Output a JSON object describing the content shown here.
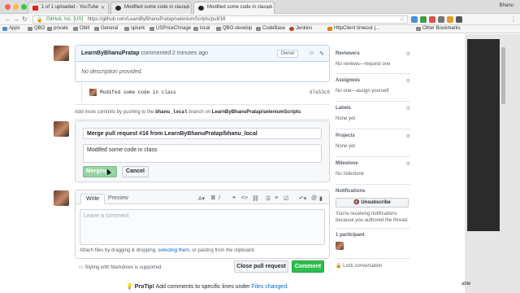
{
  "browser": {
    "tabs": [
      {
        "label": "1 of 1 uploaded - YouTube",
        "color": "#e62117"
      },
      {
        "label": "Modified some code in class b",
        "color": "#24292e"
      },
      {
        "label": "Modified some code in class b",
        "color": "#24292e"
      }
    ],
    "user": "Bhanu",
    "url_secure_label": "GitHub, Inc. [US]",
    "url": "https://github.com/LearnByBhanuPratap/seleniumScripts/pull/16",
    "bookmarks": [
      "Apps",
      "QBO",
      "private",
      "Obill",
      "General",
      "splunk",
      "USPriceChnage",
      "local",
      "QBO-develop",
      "CodeBase",
      "Jenkins",
      "HttpClient timeout |...",
      "Other Bookmarks"
    ]
  },
  "comment": {
    "author": "LearnByBhanuPratap",
    "action": "commented 2 minutes ago",
    "owner_badge": "Owner",
    "body": "No description provided."
  },
  "commit": {
    "message": "Modifed some code in class",
    "sha": "d7a53c6"
  },
  "more_commits": {
    "prefix": "Add more commits by pushing to the",
    "branch": "bhanu_local",
    "middle": "branch on",
    "repo": "LearnByBhanuPratap/seleniumScripts",
    "suffix": "."
  },
  "merge": {
    "title": "Merge pull request #16 from LearnByBhanuPratap/bhanu_local",
    "message": "Modifed some code in class",
    "merging_label": "Merging…",
    "cancel_label": "Cancel"
  },
  "new_comment": {
    "tab_write": "Write",
    "tab_preview": "Preview",
    "placeholder": "Leave a comment",
    "attach_prefix": "Attach files by dragging & dropping,",
    "attach_link": "selecting them",
    "attach_suffix": ", or pasting from the clipboard.",
    "markdown_note": "Styling with Markdown is supported",
    "close_label": "Close pull request",
    "comment_label": "Comment"
  },
  "protip": {
    "prefix": "ProTip!",
    "text": "Add comments to specific lines under",
    "link": "Files changed",
    "suffix": "."
  },
  "sidebar": {
    "reviewers_title": "Reviewers",
    "reviewers_value": "No reviews—request one",
    "assignees_title": "Assignees",
    "assignees_value": "No one—assign yourself",
    "labels_title": "Labels",
    "labels_value": "None yet",
    "projects_title": "Projects",
    "projects_value": "None yet",
    "milestone_title": "Milestone",
    "milestone_value": "No milestone",
    "notifications_title": "Notifications",
    "unsubscribe_label": "Unsubscribe",
    "notifications_note": "You're receiving notifications because you authored the thread.",
    "participants_title": "1 participant",
    "lock_label": "Lock conversation"
  },
  "right_app_label": "able"
}
